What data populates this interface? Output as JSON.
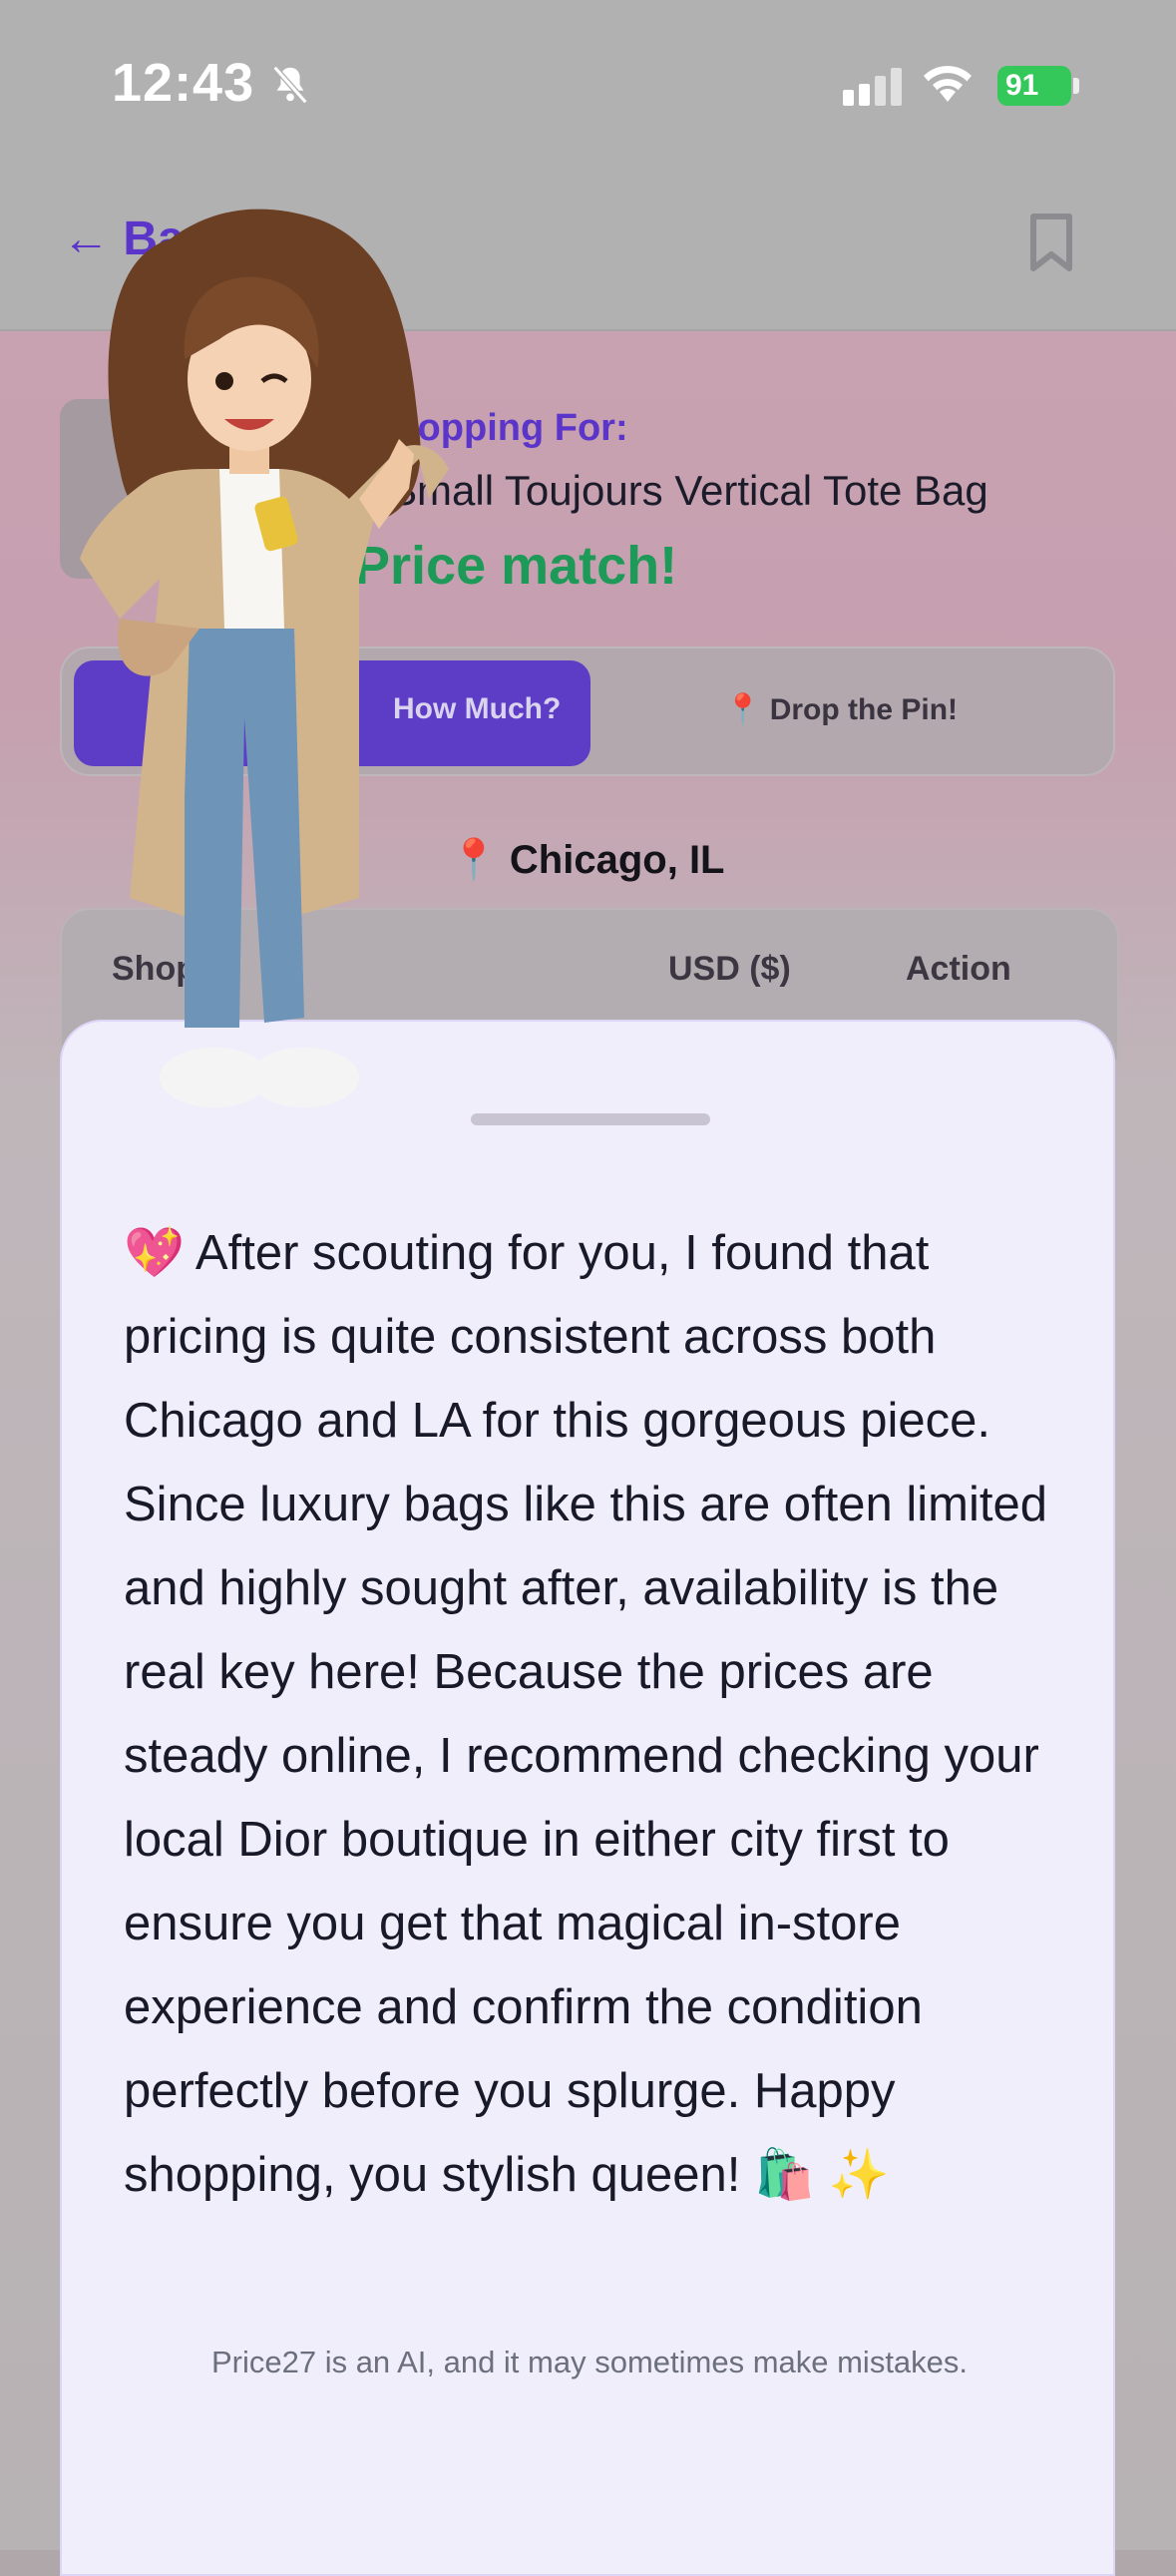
{
  "status_bar": {
    "time": "12:43",
    "battery": "91"
  },
  "nav": {
    "back_label": "← Back"
  },
  "product": {
    "shopping_label": "Shopping For:",
    "name": "Small Toujours Vertical Tote Bag",
    "match_label": "Price match!"
  },
  "tabs": [
    {
      "label": "How Much?",
      "active": true
    },
    {
      "label": "📍 Drop the Pin!",
      "active": false
    }
  ],
  "location": "📍 Chicago, IL",
  "table": {
    "columns": [
      "Shop",
      "USD ($)",
      "Action"
    ]
  },
  "assistant": {
    "message": "💖 After scouting for you, I found that pricing is quite consistent across both Chicago and LA for this gorgeous piece. Since luxury bags like this are often limited and highly sought after, availability is the real key here! Because the prices are steady online, I recommend checking your local Dior boutique in either city first to ensure you get that magical in-store experience and confirm the condition perfectly before you splurge. Happy shopping, you stylish queen! 🛍️ ✨",
    "disclaimer": "Price27 is an AI, and it may sometimes make mistakes."
  },
  "colors": {
    "accent": "#5b34c9",
    "match": "#1d9a57",
    "sheet": "#f1eefc"
  },
  "icons": [
    "bell-slash-icon",
    "signal-icon",
    "wifi-icon",
    "battery-icon",
    "bookmark-icon",
    "pin-icon"
  ]
}
